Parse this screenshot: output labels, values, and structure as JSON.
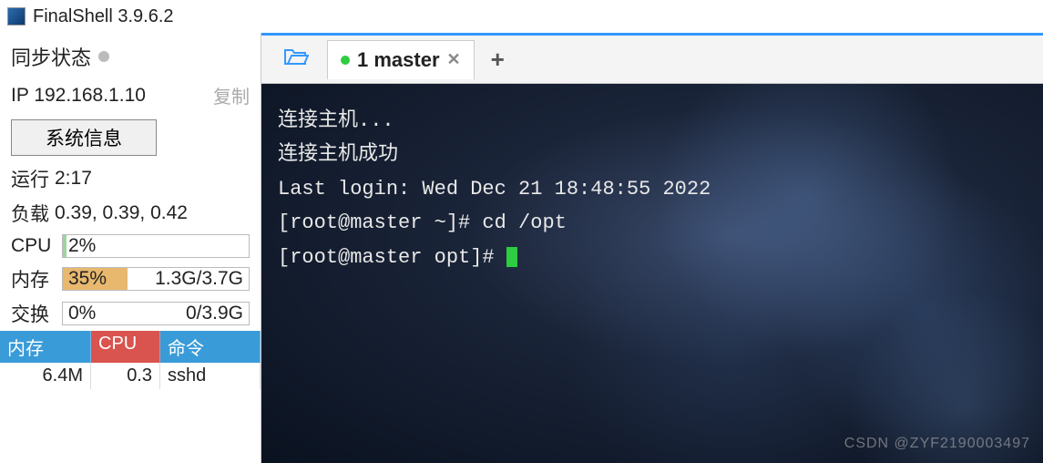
{
  "app": {
    "title": "FinalShell 3.9.6.2"
  },
  "sidebar": {
    "sync_status_label": "同步状态",
    "ip_label_prefix": "IP",
    "ip_value": "192.168.1.10",
    "copy_label": "复制",
    "sysinfo_button": "系统信息",
    "uptime_label": "运行",
    "uptime_value": "2:17",
    "load_label": "负载",
    "load_value": "0.39, 0.39, 0.42",
    "cpu_label": "CPU",
    "cpu_percent": "2%",
    "cpu_percent_num": 2,
    "mem_label": "内存",
    "mem_percent": "35%",
    "mem_percent_num": 35,
    "mem_detail": "1.3G/3.7G",
    "swap_label": "交换",
    "swap_percent": "0%",
    "swap_percent_num": 0,
    "swap_detail": "0/3.9G",
    "proc": {
      "headers": [
        "内存",
        "CPU",
        "命令"
      ],
      "row": [
        "6.4M",
        "0.3",
        "sshd"
      ]
    }
  },
  "tabs": {
    "active_label": "1 master"
  },
  "terminal": {
    "lines": [
      "连接主机...",
      "连接主机成功",
      "Last login: Wed Dec 21 18:48:55 2022",
      "[root@master ~]# cd /opt",
      "[root@master opt]# "
    ]
  },
  "watermark": "CSDN @ZYF2190003497"
}
